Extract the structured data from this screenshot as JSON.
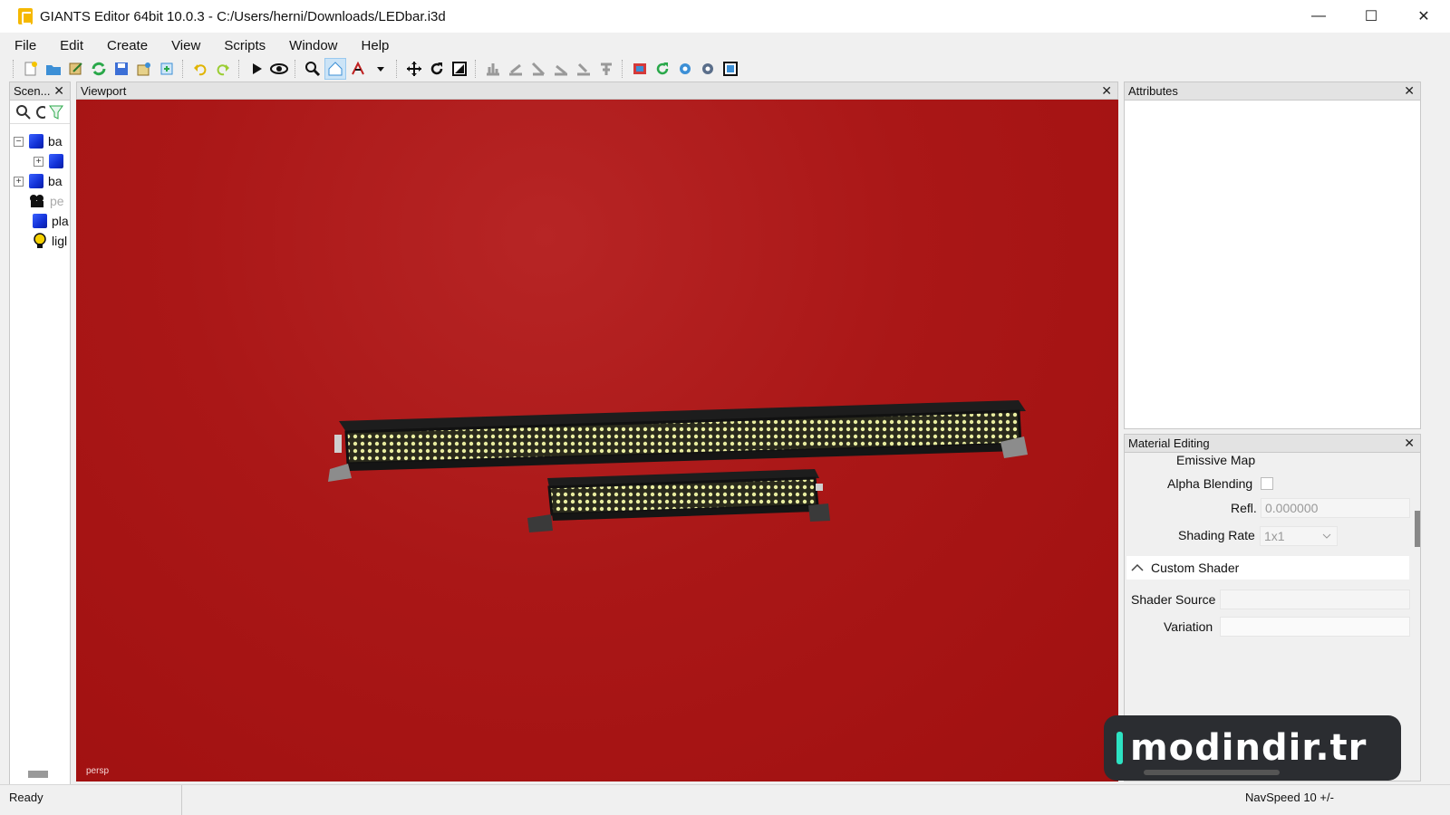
{
  "window": {
    "title": "GIANTS Editor 64bit 10.0.3 - C:/Users/herni/Downloads/LEDbar.i3d",
    "controls": {
      "minimize": "—",
      "maximize": "☐",
      "close": "✕"
    }
  },
  "menu": {
    "items": [
      "File",
      "Edit",
      "Create",
      "View",
      "Scripts",
      "Window",
      "Help"
    ]
  },
  "toolbar": {
    "icons": [
      "new-file-icon",
      "open-folder-icon",
      "edit-icon",
      "refresh-icon",
      "save-icon",
      "export-icon",
      "import-icon",
      "undo-icon",
      "redo-icon",
      "play-icon",
      "eye-icon",
      "zoom-icon",
      "home-icon",
      "paint-icon",
      "dropdown-icon",
      "move-icon",
      "rotate-icon",
      "scale-icon",
      "align-icons",
      "material-icon",
      "reload-icon",
      "settings-icons"
    ]
  },
  "scene_panel": {
    "title": "Scen...",
    "close": "✕",
    "tree": [
      {
        "label": "ba",
        "expander": "−",
        "icon": "cube-icon",
        "indent": 0,
        "dim": false
      },
      {
        "label": "",
        "expander": "+",
        "icon": "cube-icon",
        "indent": 1,
        "dim": false
      },
      {
        "label": "ba",
        "expander": "+",
        "icon": "cube-icon",
        "indent": 0,
        "dim": false
      },
      {
        "label": "pe",
        "expander": "",
        "icon": "camera-icon",
        "indent": 0,
        "dim": true
      },
      {
        "label": "pla",
        "expander": "",
        "icon": "cube-icon",
        "indent": 0,
        "dim": false
      },
      {
        "label": "ligl",
        "expander": "",
        "icon": "light-bulb-icon",
        "indent": 0,
        "dim": false
      }
    ]
  },
  "viewport": {
    "title": "Viewport",
    "close": "✕",
    "camera_label": "persp",
    "background": "#aa1717"
  },
  "attributes": {
    "title": "Attributes",
    "close": "✕"
  },
  "material_editing": {
    "title": "Material Editing",
    "close": "✕",
    "emissive_map_label": "Emissive Map",
    "alpha_blending_label": "Alpha Blending",
    "alpha_blending_checked": false,
    "refl_label": "Refl.",
    "refl_value": "0.000000",
    "shading_rate_label": "Shading Rate",
    "shading_rate_value": "1x1",
    "custom_shader_section": "Custom Shader",
    "shader_source_label": "Shader Source",
    "shader_source_value": "",
    "variation_label": "Variation",
    "variation_value": ""
  },
  "status": {
    "left": "Ready",
    "right": "NavSpeed 10 +/-"
  },
  "watermark": {
    "text": "modindir.tr",
    "accent": "#2de2c2"
  }
}
